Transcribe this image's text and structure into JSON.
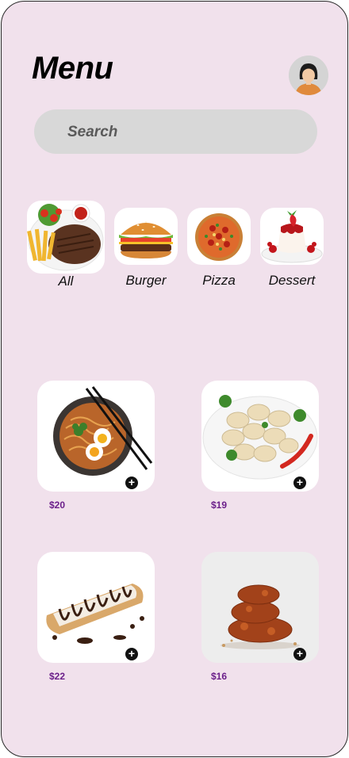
{
  "header": {
    "title": "Menu",
    "avatar_icon": "user-avatar-icon"
  },
  "search": {
    "placeholder": "Search"
  },
  "categories": [
    {
      "label": "All",
      "icon": "steak-fries-icon"
    },
    {
      "label": "Burger",
      "icon": "burger-icon"
    },
    {
      "label": "Pizza",
      "icon": "pizza-icon"
    },
    {
      "label": "Dessert",
      "icon": "panna-cotta-icon"
    }
  ],
  "items": [
    {
      "price": "$20",
      "image": "ramen-image"
    },
    {
      "price": "$19",
      "image": "dumplings-image"
    },
    {
      "price": "$22",
      "image": "chocolate-roll-image"
    },
    {
      "price": "$16",
      "image": "fried-chicken-image"
    }
  ],
  "add_symbol": "+",
  "colors": {
    "background": "#f1e1ec",
    "price": "#6b1f8a",
    "search_bg": "#d8d8d8"
  }
}
